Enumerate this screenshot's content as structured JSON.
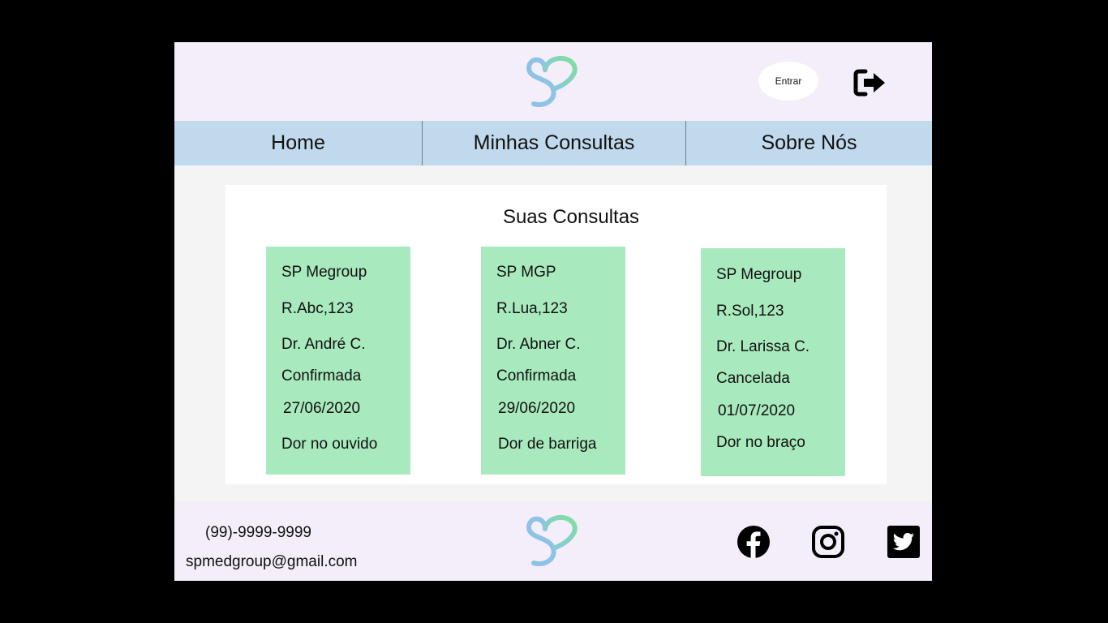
{
  "header": {
    "login_label": "Entrar",
    "logo_icon": "heart-s-logo",
    "logout_icon": "sign-out-icon"
  },
  "nav": {
    "items": [
      {
        "label": "Home"
      },
      {
        "label": "Minhas Consultas"
      },
      {
        "label": "Sobre Nós"
      }
    ]
  },
  "main": {
    "title": "Suas Consultas",
    "appointments": [
      {
        "clinic": "SP Megroup",
        "address": "R.Abc,123",
        "doctor": "Dr. André C.",
        "status": "Confirmada",
        "date": "27/06/2020",
        "description": "Dor no ouvido"
      },
      {
        "clinic": "SP MGP",
        "address": "R.Lua,123",
        "doctor": "Dr. Abner C.",
        "status": "Confirmada",
        "date": "29/06/2020",
        "description": "Dor de barriga"
      },
      {
        "clinic": "SP Megroup",
        "address": "R.Sol,123",
        "doctor": "Dr. Larissa C.",
        "status": "Cancelada",
        "date": "01/07/2020",
        "description": "Dor no braço"
      }
    ]
  },
  "footer": {
    "phone": "(99)-9999-9999",
    "email": "spmedgroup@gmail.com",
    "social_icons": [
      "facebook-icon",
      "instagram-icon",
      "twitter-icon"
    ]
  },
  "colors": {
    "page_background": "#000000",
    "header_background": "#f3eefa",
    "nav_background": "#c0d9ec",
    "content_background": "#f4f4f4",
    "card_background": "#a8e9bd",
    "logo_blue": "#8ec3e6",
    "logo_green": "#7fe0a0"
  }
}
